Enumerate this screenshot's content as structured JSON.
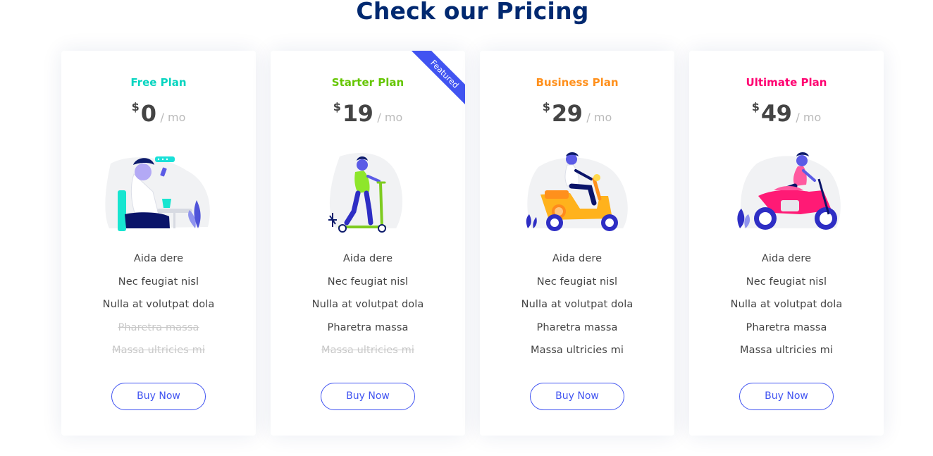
{
  "section": {
    "title": "Check our Pricing"
  },
  "plans": [
    {
      "name": "Free Plan",
      "color": "#07d5c0",
      "currency": "$",
      "amount": "0",
      "period": "/ mo",
      "featured": false,
      "illustration": "person-sitting-with-phone",
      "features": [
        {
          "text": "Aida dere",
          "available": true
        },
        {
          "text": "Nec feugiat nisl",
          "available": true
        },
        {
          "text": "Nulla at volutpat dola",
          "available": true
        },
        {
          "text": "Pharetra massa",
          "available": false
        },
        {
          "text": "Massa ultricies mi",
          "available": false
        }
      ],
      "button": "Buy Now"
    },
    {
      "name": "Starter Plan",
      "color": "#65c600",
      "currency": "$",
      "amount": "19",
      "period": "/ mo",
      "featured": true,
      "ribbon": "Featured",
      "illustration": "person-on-kick-scooter",
      "features": [
        {
          "text": "Aida dere",
          "available": true
        },
        {
          "text": "Nec feugiat nisl",
          "available": true
        },
        {
          "text": "Nulla at volutpat dola",
          "available": true
        },
        {
          "text": "Pharetra massa",
          "available": true
        },
        {
          "text": "Massa ultricies mi",
          "available": false
        }
      ],
      "button": "Buy Now"
    },
    {
      "name": "Business Plan",
      "color": "#ff901c",
      "currency": "$",
      "amount": "29",
      "period": "/ mo",
      "featured": false,
      "illustration": "person-on-motor-scooter",
      "features": [
        {
          "text": "Aida dere",
          "available": true
        },
        {
          "text": "Nec feugiat nisl",
          "available": true
        },
        {
          "text": "Nulla at volutpat dola",
          "available": true
        },
        {
          "text": "Pharetra massa",
          "available": true
        },
        {
          "text": "Massa ultricies mi",
          "available": true
        }
      ],
      "button": "Buy Now"
    },
    {
      "name": "Ultimate Plan",
      "color": "#ff0071",
      "currency": "$",
      "amount": "49",
      "period": "/ mo",
      "featured": false,
      "illustration": "person-on-motorcycle",
      "features": [
        {
          "text": "Aida dere",
          "available": true
        },
        {
          "text": "Nec feugiat nisl",
          "available": true
        },
        {
          "text": "Nulla at volutpat dola",
          "available": true
        },
        {
          "text": "Pharetra massa",
          "available": true
        },
        {
          "text": "Massa ultricies mi",
          "available": true
        }
      ],
      "button": "Buy Now"
    }
  ]
}
